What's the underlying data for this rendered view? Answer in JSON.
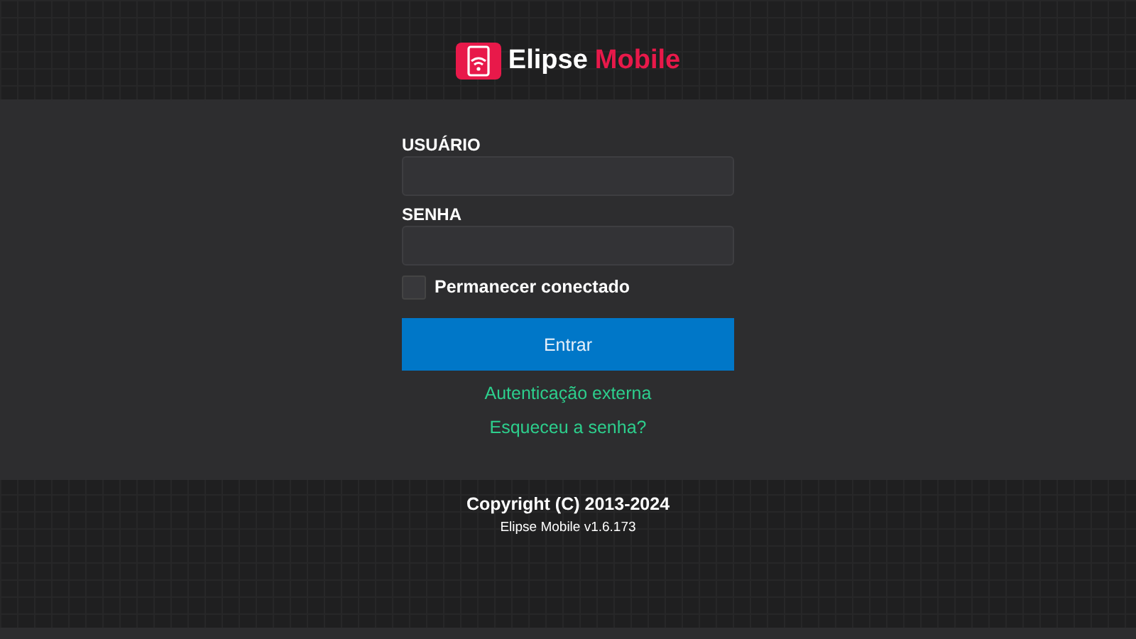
{
  "header": {
    "logo_first": "Elipse",
    "logo_second": "Mobile"
  },
  "form": {
    "fields": [
      {
        "label": "USUÁRIO"
      },
      {
        "label": "SENHA"
      }
    ],
    "remember": {
      "label": "Permanecer conectado",
      "checked": false
    },
    "submit": "Entrar",
    "links": [
      "Autenticação externa",
      "Esqueceu a senha?"
    ]
  },
  "footer": {
    "copyright": "Copyright (C) 2013-2024",
    "version": "Elipse Mobile v1.6.173"
  }
}
